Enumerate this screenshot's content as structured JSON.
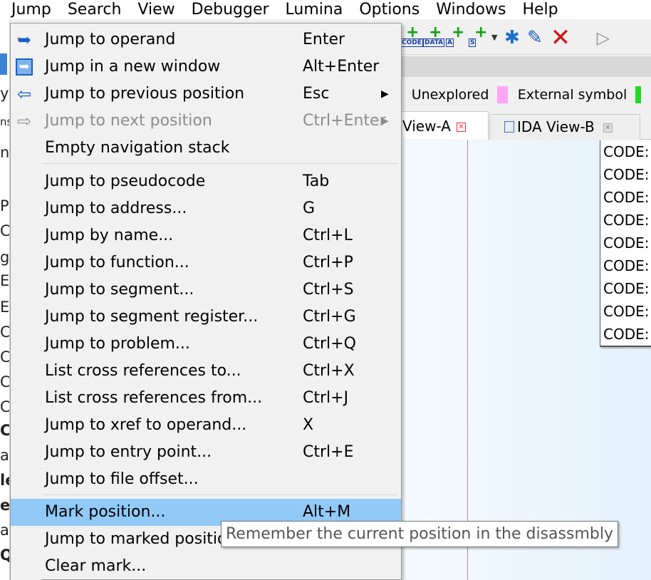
{
  "menubar": {
    "items": [
      "Jump",
      "Search",
      "View",
      "Debugger",
      "Lumina",
      "Options",
      "Windows",
      "Help"
    ]
  },
  "toolbar": {
    "icon_labels": [
      "CODE",
      "DATA",
      "A",
      "S"
    ]
  },
  "legend": {
    "unexplored": "Unexplored",
    "external_symbol": "External symbol"
  },
  "tabs": {
    "view_a": "View-A",
    "view_b": "IDA View-B"
  },
  "code_lines": [
    "CODE:",
    "CODE:",
    "CODE:",
    "CODE:",
    "CODE:",
    "CODE:",
    "CODE:",
    "CODE:",
    "CODE:"
  ],
  "left_strip_chars": [
    "y",
    "ns",
    "n",
    "Pr",
    "C",
    "g",
    "E",
    "E",
    "C",
    "C",
    "C",
    "C",
    "C",
    "a",
    "le",
    "e",
    "a",
    "Q"
  ],
  "jump_menu": {
    "items": [
      {
        "label": "Jump to operand",
        "shortcut": "Enter",
        "icon": "jump-operand-icon"
      },
      {
        "label": "Jump in a new window",
        "shortcut": "Alt+Enter",
        "icon": "new-window-icon"
      },
      {
        "label": "Jump to previous position",
        "shortcut": "Esc",
        "icon": "back-arrow-icon",
        "submenu": true
      },
      {
        "label": "Jump to next position",
        "shortcut": "Ctrl+Enter",
        "icon": "forward-arrow-icon",
        "disabled": true,
        "submenu": true
      },
      {
        "label": "Empty navigation stack",
        "shortcut": ""
      },
      {
        "label": "Jump to pseudocode",
        "shortcut": "Tab"
      },
      {
        "label": "Jump to address...",
        "shortcut": "G"
      },
      {
        "label": "Jump by name...",
        "shortcut": "Ctrl+L"
      },
      {
        "label": "Jump to function...",
        "shortcut": "Ctrl+P"
      },
      {
        "label": "Jump to segment...",
        "shortcut": "Ctrl+S"
      },
      {
        "label": "Jump to segment register...",
        "shortcut": "Ctrl+G"
      },
      {
        "label": "Jump to problem...",
        "shortcut": "Ctrl+Q"
      },
      {
        "label": "List cross references to...",
        "shortcut": "Ctrl+X"
      },
      {
        "label": "List cross references from...",
        "shortcut": "Ctrl+J"
      },
      {
        "label": "Jump to xref to operand...",
        "shortcut": "X"
      },
      {
        "label": "Jump to entry point...",
        "shortcut": "Ctrl+E"
      },
      {
        "label": "Jump to file offset...",
        "shortcut": ""
      },
      {
        "label": "Mark position...",
        "shortcut": "Alt+M",
        "highlighted": true
      },
      {
        "label": "Jump to marked position...",
        "shortcut": ""
      },
      {
        "label": "Clear mark...",
        "shortcut": ""
      }
    ]
  },
  "tooltip": {
    "text": "Remember the current position in the disassmbly"
  },
  "colors": {
    "highlight": "#91c9f7",
    "unexplored": "#c1a26b",
    "external_symbol": "#ffa6f5",
    "delete_red": "#d91010"
  }
}
